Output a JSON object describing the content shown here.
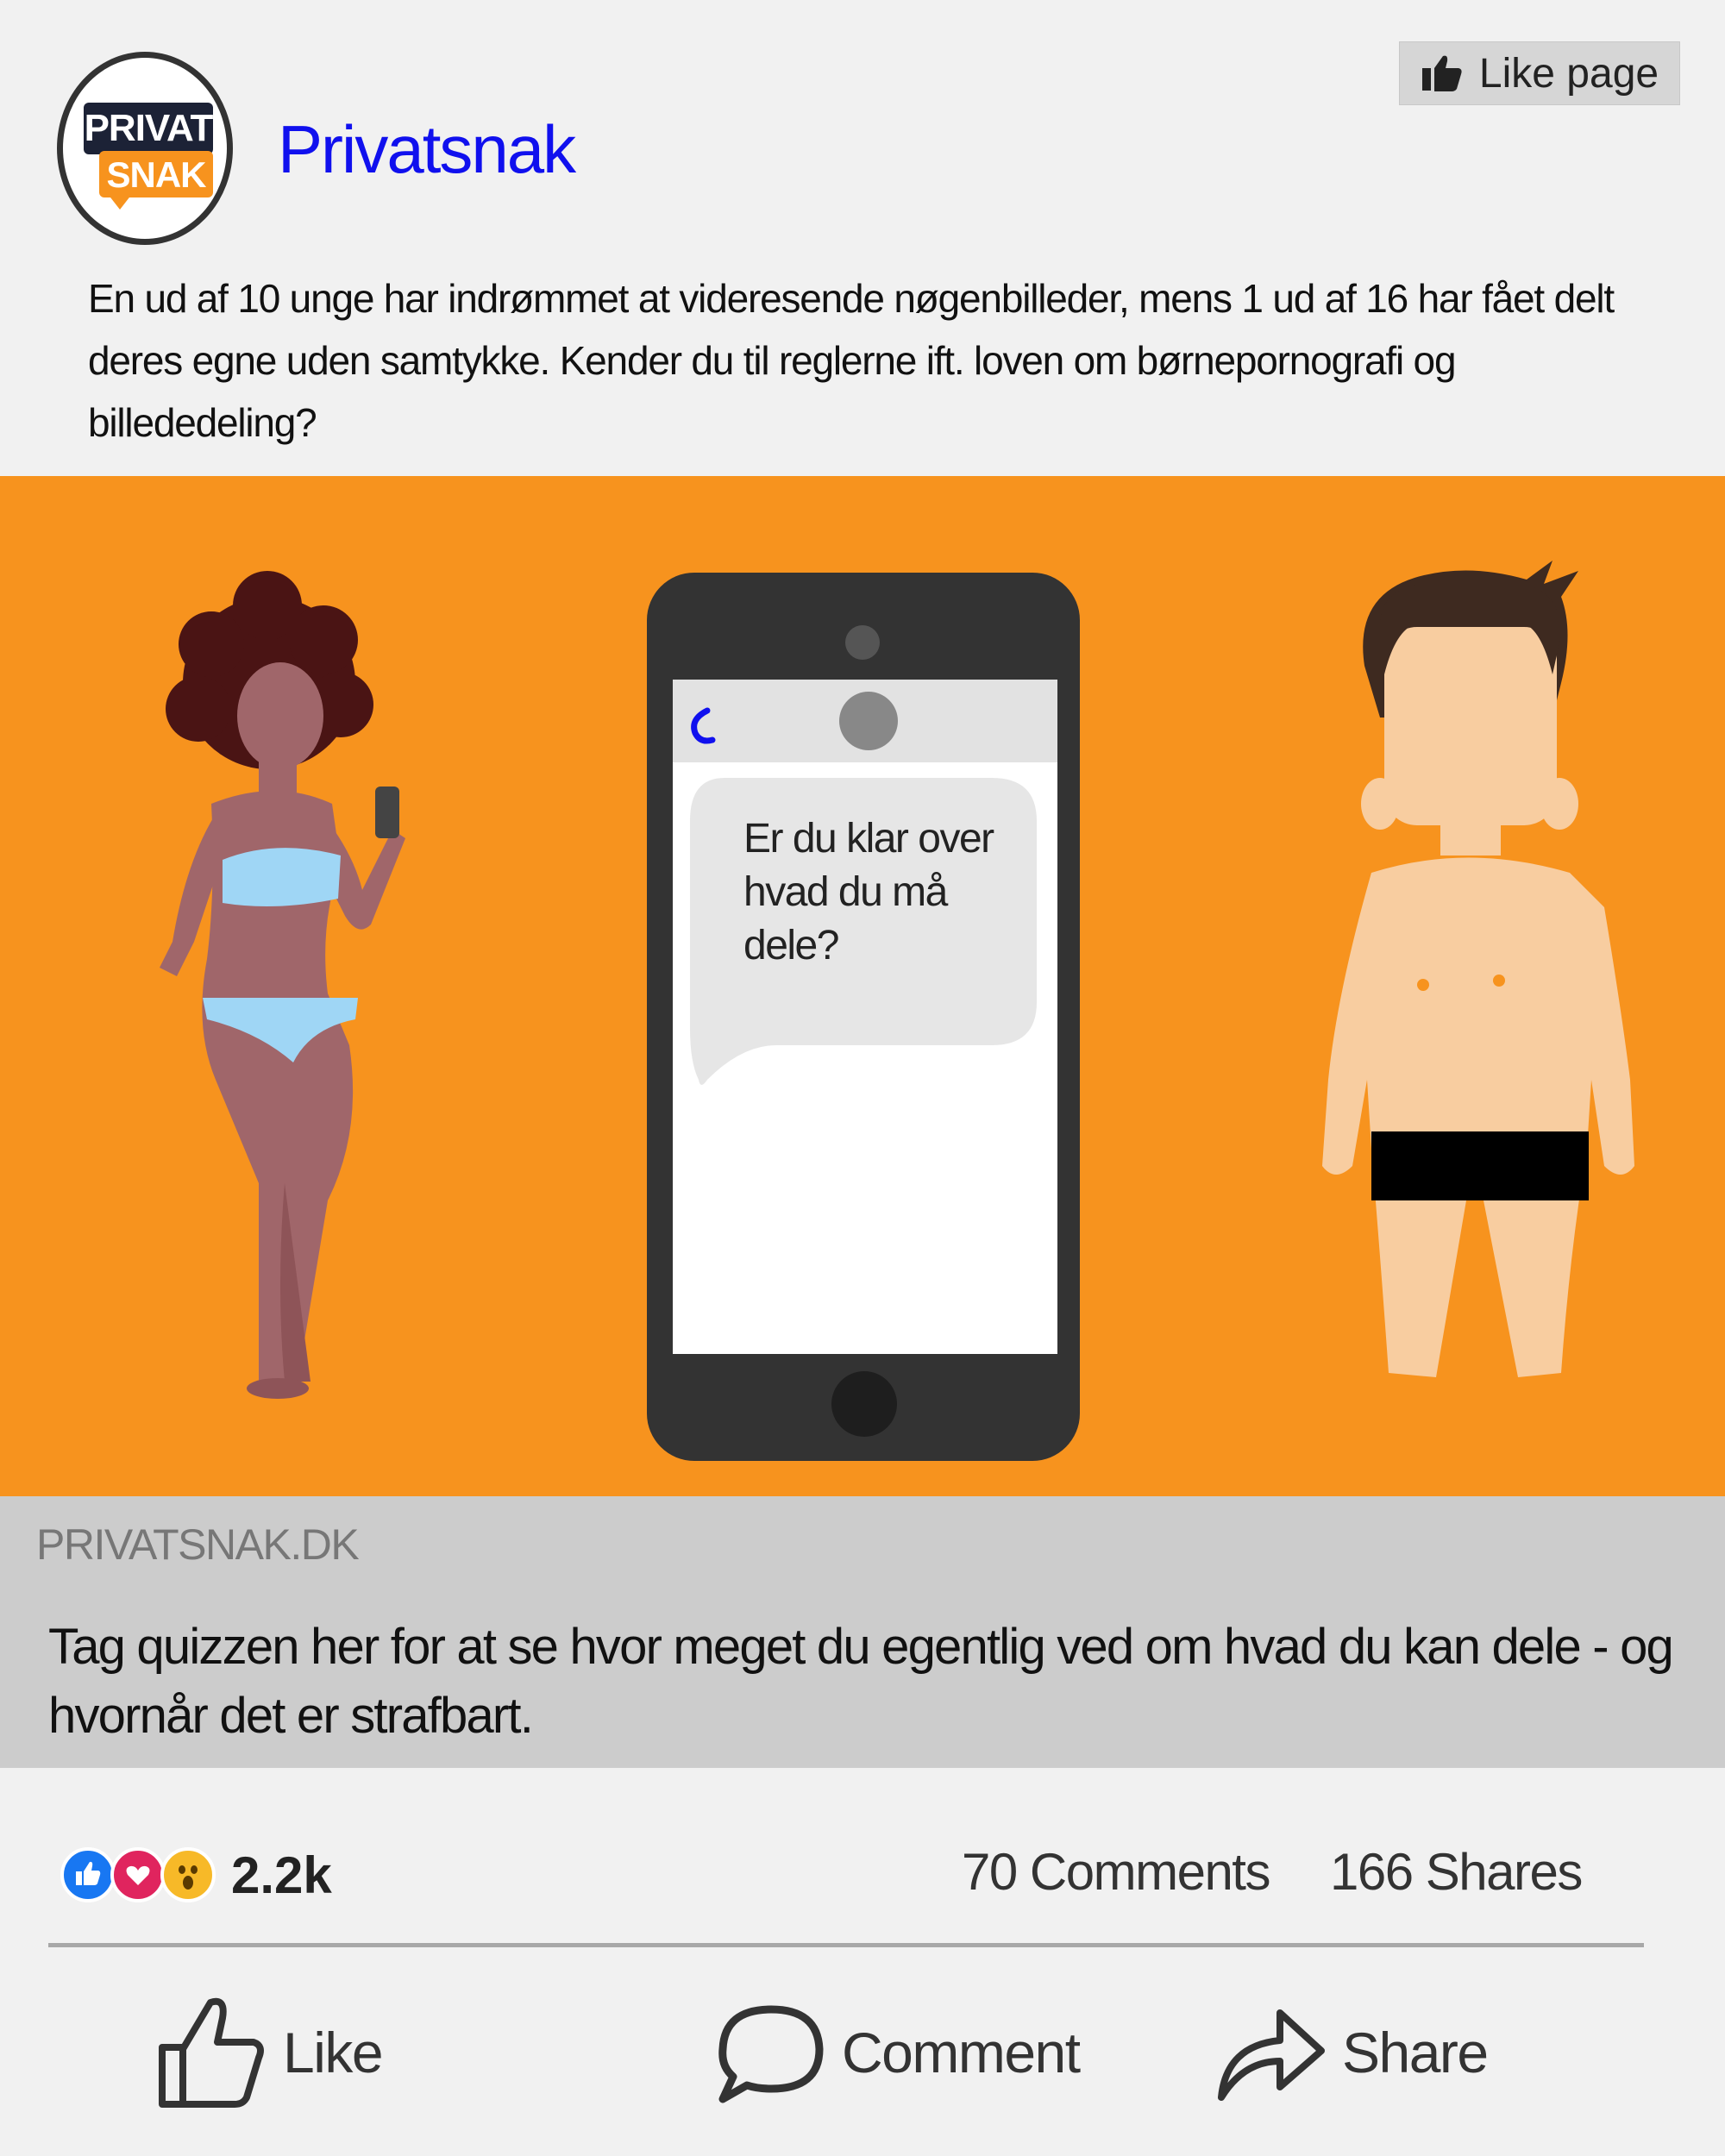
{
  "page": {
    "logo_top": "PRIVAT",
    "logo_bottom": "SNAK",
    "name": "Privatsnak",
    "like_page_label": "Like page"
  },
  "post": {
    "text": "En ud af 10 unge har indrømmet at videresende nøgenbilleder, mens 1 ud af 16 har fået delt deres egne uden samtykke. Kender du til reglerne ift. loven om børnepornografi og billededeling?"
  },
  "illustration": {
    "bubble_text": "Er du klar over hvad du må dele?",
    "background_color": "#f7931e"
  },
  "link_preview": {
    "domain": "PRIVATSNAK.DK",
    "title": "Tag quizzen her for at se hvor meget du egentlig ved om hvad du kan dele - og hvornår det er strafbart."
  },
  "stats": {
    "reactions": [
      "like-icon",
      "love-icon",
      "wow-icon"
    ],
    "reaction_count": "2.2k",
    "comments": "70 Comments",
    "shares": "166 Shares"
  },
  "actions": {
    "like": "Like",
    "comment": "Comment",
    "share": "Share"
  },
  "colors": {
    "brand_blue": "#1010ee",
    "accent_orange": "#f7931e",
    "like_blue": "#1877f2",
    "love_red": "#e0245e",
    "wow_yellow": "#f7b928"
  }
}
